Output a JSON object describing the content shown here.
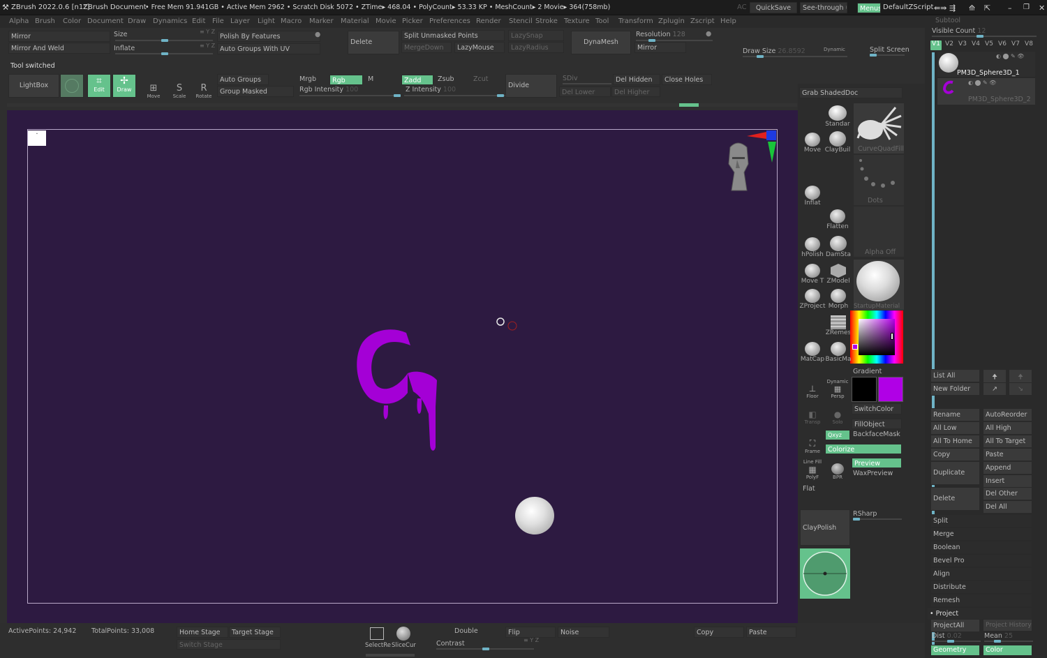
{
  "titlebar": {
    "app": "ZBrush 2022.0.6 [n1z]",
    "doc": "ZBrush Document",
    "stats": "• Free Mem 91.941GB • Active Mem 2962 • Scratch Disk 5072 • ZTime▸ 468.04 • PolyCount▸ 53.33 KP • MeshCount▸ 2  Movie▸ 364(758mb)",
    "quicksave": "QuickSave",
    "seethrough": "See-through",
    "seethrough_val": "0",
    "menus": "Menus",
    "defaultzscript": "DefaultZScript"
  },
  "menus": [
    "Alpha",
    "Brush",
    "Color",
    "Document",
    "Draw",
    "Dynamics",
    "Edit",
    "File",
    "Layer",
    "Light",
    "Macro",
    "Marker",
    "Material",
    "Movie",
    "Picker",
    "Preferences",
    "Render",
    "Stencil",
    "Stroke",
    "Texture",
    "Tool",
    "Transform",
    "Zplugin",
    "Zscript",
    "Help"
  ],
  "toolbar1": {
    "mirror": "Mirror",
    "mirror_weld": "Mirror And Weld",
    "size": "Size",
    "inflate": "Inflate",
    "xyz1": "≡ Y Z",
    "xyz2": "≡ Y Z",
    "polish_features": "Polish By Features",
    "auto_groups_uv": "Auto Groups With UV",
    "delete": "Delete",
    "split_unmasked": "Split Unmasked Points",
    "lazysnap": "LazySnap",
    "mergedown": "MergeDown",
    "lazymouse": "LazyMouse",
    "lazyradius": "LazyRadius",
    "dynamesh": "DynaMesh",
    "resolution": "Resolution",
    "resolution_val": "128",
    "mirror2": "Mirror",
    "draw_size": "Draw Size",
    "draw_size_val": "26.8592",
    "dynamic": "Dynamic",
    "split_screen": "Split Screen"
  },
  "notice": "Tool switched",
  "toolbar2": {
    "lightbox": "LightBox",
    "edit": "Edit",
    "draw": "Draw",
    "move": "Move",
    "scale": "Scale",
    "rotate": "Rotate",
    "auto_groups": "Auto Groups",
    "group_masked": "Group Masked",
    "mrgb": "Mrgb",
    "rgb": "Rgb",
    "m": "M",
    "rgb_intensity": "Rgb Intensity",
    "rgb_intensity_val": "100",
    "zadd": "Zadd",
    "zsub": "Zsub",
    "zcut": "Zcut",
    "z_intensity": "Z Intensity",
    "z_intensity_val": "100",
    "divide": "Divide",
    "sdiv": "SDiv",
    "del_hidden": "Del Hidden",
    "close_holes": "Close Holes",
    "del_lower": "Del Lower",
    "del_higher": "Del Higher"
  },
  "brushpanel": {
    "grab_doc": "Grab ShadedDoc",
    "standard": "Standar",
    "move": "Move",
    "claybuild": "ClayBuil",
    "curvequadfill": "CurveQuadFill",
    "dots": "Dots",
    "inflat": "Inflat",
    "flatten": "Flatten",
    "alpha_off": "Alpha Off",
    "hpolish": "hPolish",
    "damstandard": "DamSta",
    "move_t": "Move T",
    "tzmodeler": "ZModel",
    "startupmaterial": "StartupMaterial",
    "zproject": "ZProject",
    "morph": "Morph",
    "zremesh": "ZRemes",
    "matcap": "MatCap",
    "basicmat": "BasicMa",
    "gradient": "Gradient",
    "switchcolor": "SwitchColor",
    "floor": "Floor",
    "persp": "Persp",
    "transp": "Transp",
    "solo": "Solo",
    "fillobject": "FillObject",
    "xyz": "Qxyz",
    "backfacemask": "BackfaceMask",
    "frame": "Frame",
    "colorize": "Colorize",
    "linefill": "Line Fill",
    "polyf": "PolyF",
    "bpr": "BPR",
    "preview": "Preview",
    "waxpreview": "WaxPreview",
    "flat": "Flat",
    "rsharp": "RSharp",
    "claypolish": "ClayPolish",
    "dynamic_label": "Dynamic"
  },
  "subtool": {
    "header": "Subtool",
    "visible_count": "Visible Count",
    "visible_count_val": "12",
    "versions": [
      "V1",
      "V2",
      "V3",
      "V4",
      "V5",
      "V6",
      "V7",
      "V8"
    ],
    "items": [
      "PM3D_Sphere3D_1",
      "PM3D_Sphere3D_2"
    ],
    "list_all": "List All",
    "new_folder": "New Folder",
    "rename": "Rename",
    "autoreorder": "AutoReorder",
    "all_low": "All Low",
    "all_high": "All High",
    "all_to_home": "All To Home",
    "all_to_target": "All To Target",
    "copy": "Copy",
    "paste": "Paste",
    "duplicate": "Duplicate",
    "append": "Append",
    "insert": "Insert",
    "delete": "Delete",
    "del_other": "Del Other",
    "del_all": "Del All",
    "split": "Split",
    "merge": "Merge",
    "boolean": "Boolean",
    "bevel_pro": "Bevel Pro",
    "align": "Align",
    "distribute": "Distribute",
    "remesh": "Remesh",
    "project": "Project",
    "projectall": "ProjectAll",
    "project_history": "Project History",
    "dist": "Dist",
    "dist_val": "0.02",
    "mean": "Mean",
    "mean_val": "25",
    "geometry": "Geometry",
    "color": "Color"
  },
  "status": {
    "active_points": "ActivePoints: 24,942",
    "total_points": "TotalPoints: 33,008",
    "home_stage": "Home Stage",
    "target_stage": "Target Stage",
    "switch_stage": "Switch Stage",
    "selectrect": "SelectRe",
    "slicecurve": "SliceCur",
    "double": "Double",
    "flip": "Flip",
    "noise": "Noise",
    "contrast": "Contrast",
    "copy": "Copy",
    "paste": "Paste"
  },
  "colors": {
    "accent_green": "#65c28c",
    "canvas_bg": "#2d1a41",
    "stroke_purple": "#a400d6",
    "main_color": "#b000e6",
    "secondary_color": "#000000"
  }
}
